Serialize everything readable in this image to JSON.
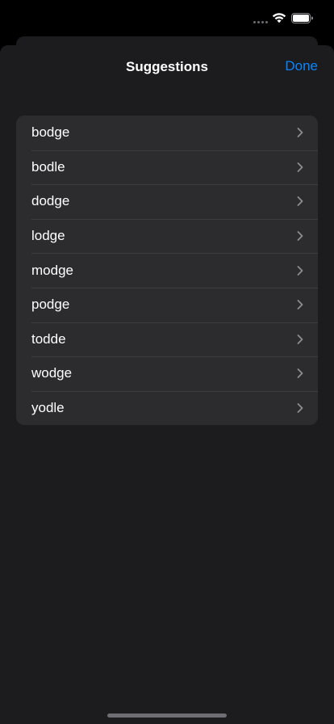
{
  "nav": {
    "title": "Suggestions",
    "done_label": "Done"
  },
  "suggestions": [
    {
      "label": "bodge"
    },
    {
      "label": "bodle"
    },
    {
      "label": "dodge"
    },
    {
      "label": "lodge"
    },
    {
      "label": "modge"
    },
    {
      "label": "podge"
    },
    {
      "label": "todde"
    },
    {
      "label": "wodge"
    },
    {
      "label": "yodle"
    }
  ],
  "icons": {
    "row": "chevron-right-icon",
    "status": [
      "cellular-signal-icon",
      "wifi-icon",
      "battery-icon"
    ]
  },
  "colors": {
    "accent": "#0a84ff",
    "sheet_background": "#1c1c1e",
    "list_background": "#2c2c2e"
  }
}
